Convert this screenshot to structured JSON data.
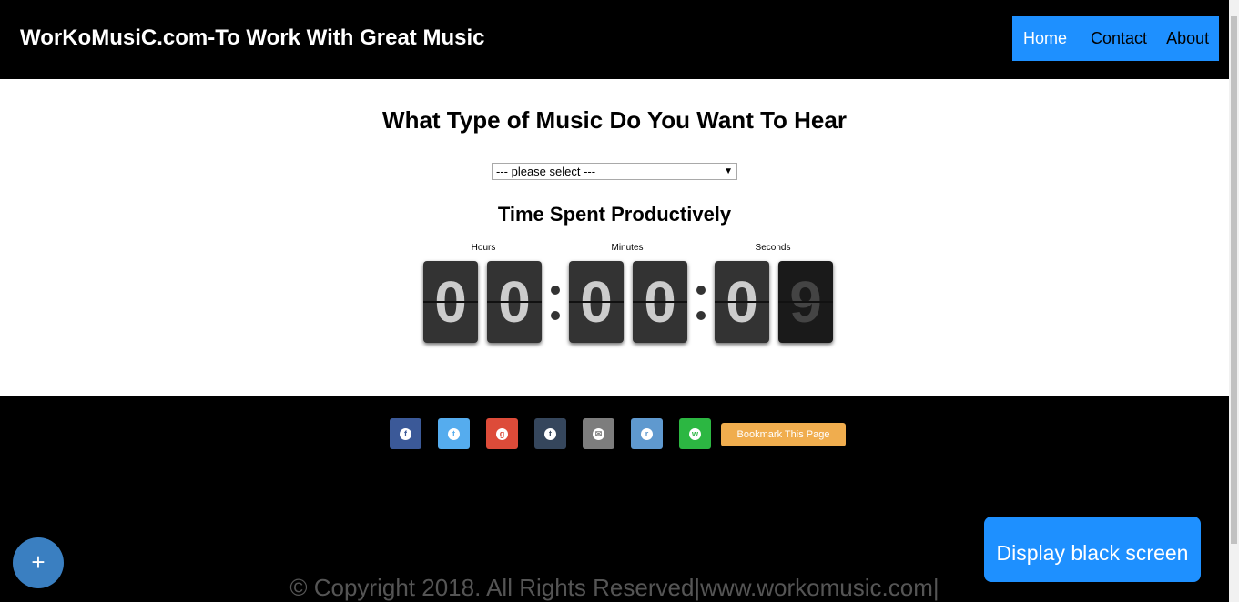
{
  "header": {
    "site_title": "WorKoMusiC.com-To Work With Great Music",
    "nav": {
      "home": "Home",
      "contact": "Contact",
      "about": "About"
    },
    "nav_color": "#1e90ff"
  },
  "main": {
    "heading": "What Type of Music Do You Want To Hear",
    "select": {
      "selected": "--- please select ---",
      "arrow": "▼"
    },
    "timer_heading": "Time Spent Productively",
    "timer": {
      "labels": {
        "hours": "Hours",
        "minutes": "Minutes",
        "seconds": "Seconds"
      },
      "digits": [
        "0",
        "0",
        "0",
        "0",
        "0",
        "9"
      ]
    }
  },
  "footer": {
    "share": [
      {
        "icon": "facebook-icon",
        "glyph": "f",
        "color": "#3b5998"
      },
      {
        "icon": "twitter-icon",
        "glyph": "t",
        "color": "#55acee"
      },
      {
        "icon": "google-plus-icon",
        "glyph": "g",
        "color": "#dd4b39"
      },
      {
        "icon": "tumblr-icon",
        "glyph": "t",
        "color": "#35465c"
      },
      {
        "icon": "email-icon",
        "glyph": "✉",
        "color": "#7d7d7d"
      },
      {
        "icon": "reddit-icon",
        "glyph": "r",
        "color": "#5f99cf"
      },
      {
        "icon": "whatsapp-icon",
        "glyph": "w",
        "color": "#2cb742"
      }
    ],
    "bookmark_label": "Bookmark This Page",
    "bookmark_color": "#f0ad4e",
    "copyright": "© Copyright 2018.  All Rights Reserved|www.workomusic.com|"
  },
  "display_button": "Display black screen",
  "fab_label": "+"
}
